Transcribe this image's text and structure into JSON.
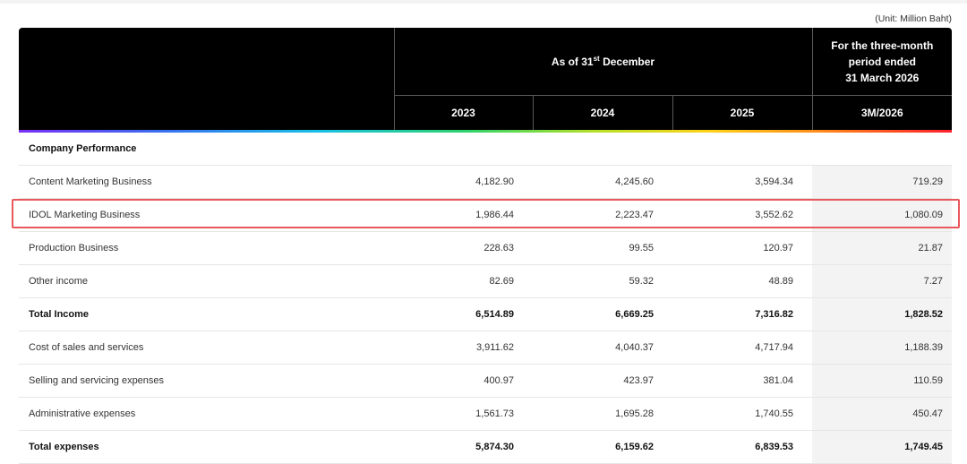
{
  "unit_note": "(Unit: Million Baht)",
  "header": {
    "as_of_prefix": "As of 31",
    "as_of_sup": "st",
    "as_of_suffix": " December",
    "period_line1": "For the three-month",
    "period_line2": "period ended",
    "period_line3": "31 March 2026",
    "years": [
      "2023",
      "2024",
      "2025",
      "3M/2026"
    ]
  },
  "section_title": "Company Performance",
  "rows": [
    {
      "label": "Content Marketing Business",
      "values": [
        "4,182.90",
        "4,245.60",
        "3,594.34",
        "719.29"
      ],
      "bold": false
    },
    {
      "label": "IDOL Marketing Business",
      "values": [
        "1,986.44",
        "2,223.47",
        "3,552.62",
        "1,080.09"
      ],
      "bold": false,
      "highlighted": true
    },
    {
      "label": "Production Business",
      "values": [
        "228.63",
        "99.55",
        "120.97",
        "21.87"
      ],
      "bold": false
    },
    {
      "label": "Other income",
      "values": [
        "82.69",
        "59.32",
        "48.89",
        "7.27"
      ],
      "bold": false
    },
    {
      "label": "Total Income",
      "values": [
        "6,514.89",
        "6,669.25",
        "7,316.82",
        "1,828.52"
      ],
      "bold": true
    },
    {
      "label": "Cost of sales and services",
      "values": [
        "3,911.62",
        "4,040.37",
        "4,717.94",
        "1,188.39"
      ],
      "bold": false
    },
    {
      "label": "Selling and servicing expenses",
      "values": [
        "400.97",
        "423.97",
        "381.04",
        "110.59"
      ],
      "bold": false
    },
    {
      "label": "Administrative expenses",
      "values": [
        "1,561.73",
        "1,695.28",
        "1,740.55",
        "450.47"
      ],
      "bold": false
    },
    {
      "label": "Total expenses",
      "values": [
        "5,874.30",
        "6,159.62",
        "6,839.53",
        "1,749.45"
      ],
      "bold": true
    }
  ],
  "colors": {
    "header_bg": "#000000",
    "highlight_border": "#e8585b",
    "quarter_col_bg": "#f3f3f3"
  }
}
